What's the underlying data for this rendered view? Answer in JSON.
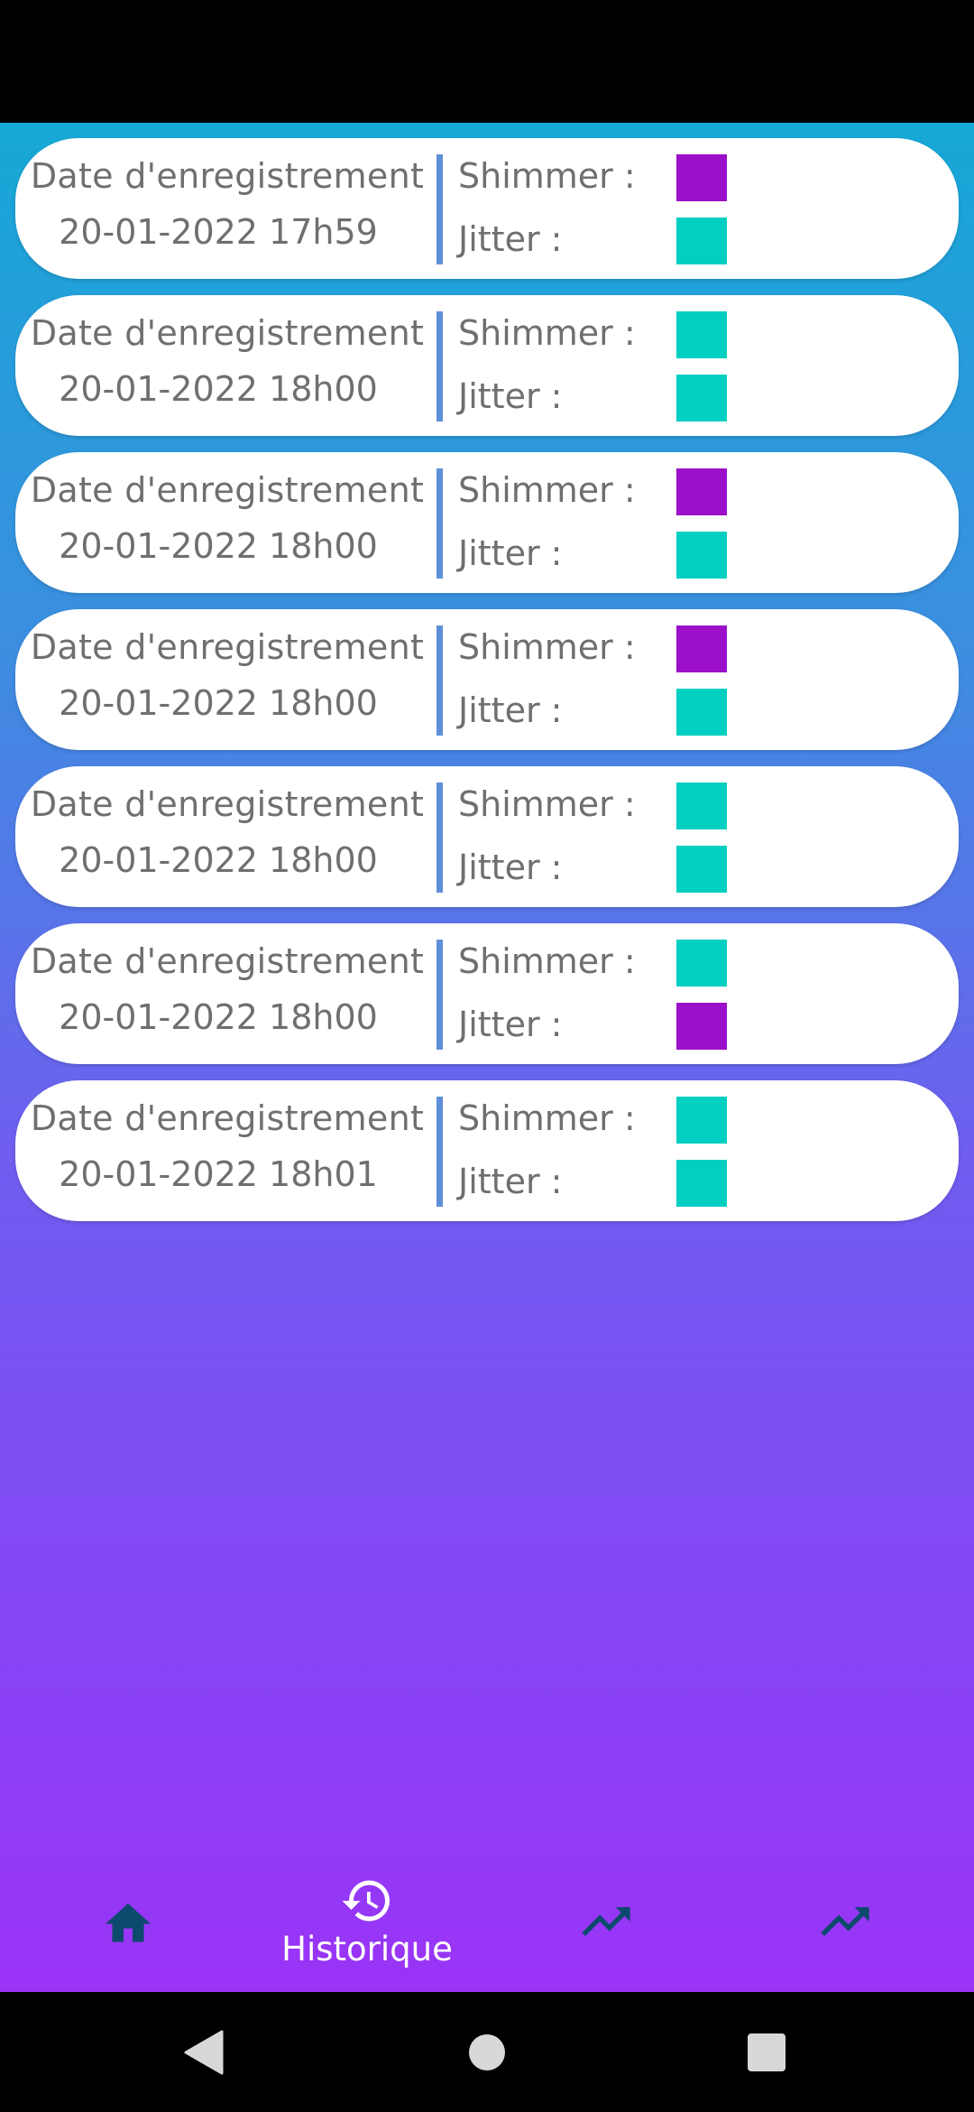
{
  "colors": {
    "purple_status": "#9b10c8",
    "teal_status": "#00cfc1",
    "divider": "#5f8fd8",
    "nav_icon": "#0c4a6e"
  },
  "records": [
    {
      "label": "Date d'enregistrement",
      "date": "20-01-2022 17h59",
      "shimmer_label": "Shimmer :",
      "jitter_label": "Jitter :",
      "shimmer_color": "#9b10c8",
      "jitter_color": "#00cfc1"
    },
    {
      "label": "Date d'enregistrement",
      "date": "20-01-2022 18h00",
      "shimmer_label": "Shimmer :",
      "jitter_label": "Jitter :",
      "shimmer_color": "#00cfc1",
      "jitter_color": "#00cfc1"
    },
    {
      "label": "Date d'enregistrement",
      "date": "20-01-2022 18h00",
      "shimmer_label": "Shimmer :",
      "jitter_label": "Jitter :",
      "shimmer_color": "#9b10c8",
      "jitter_color": "#00cfc1"
    },
    {
      "label": "Date d'enregistrement",
      "date": "20-01-2022 18h00",
      "shimmer_label": "Shimmer :",
      "jitter_label": "Jitter :",
      "shimmer_color": "#9b10c8",
      "jitter_color": "#00cfc1"
    },
    {
      "label": "Date d'enregistrement",
      "date": "20-01-2022 18h00",
      "shimmer_label": "Shimmer :",
      "jitter_label": "Jitter :",
      "shimmer_color": "#00cfc1",
      "jitter_color": "#00cfc1"
    },
    {
      "label": "Date d'enregistrement",
      "date": "20-01-2022 18h00",
      "shimmer_label": "Shimmer :",
      "jitter_label": "Jitter :",
      "shimmer_color": "#00cfc1",
      "jitter_color": "#9b10c8"
    },
    {
      "label": "Date d'enregistrement",
      "date": "20-01-2022 18h01",
      "shimmer_label": "Shimmer :",
      "jitter_label": "Jitter :",
      "shimmer_color": "#00cfc1",
      "jitter_color": "#00cfc1"
    }
  ],
  "bottom_nav": {
    "items": [
      {
        "icon": "home-icon",
        "label": ""
      },
      {
        "icon": "history-icon",
        "label": "Historique",
        "active": true
      },
      {
        "icon": "trending-up-icon",
        "label": ""
      },
      {
        "icon": "trending-up-icon",
        "label": ""
      }
    ]
  },
  "system_nav": {
    "icons": [
      "back-icon",
      "home-circle-icon",
      "recents-icon"
    ]
  }
}
